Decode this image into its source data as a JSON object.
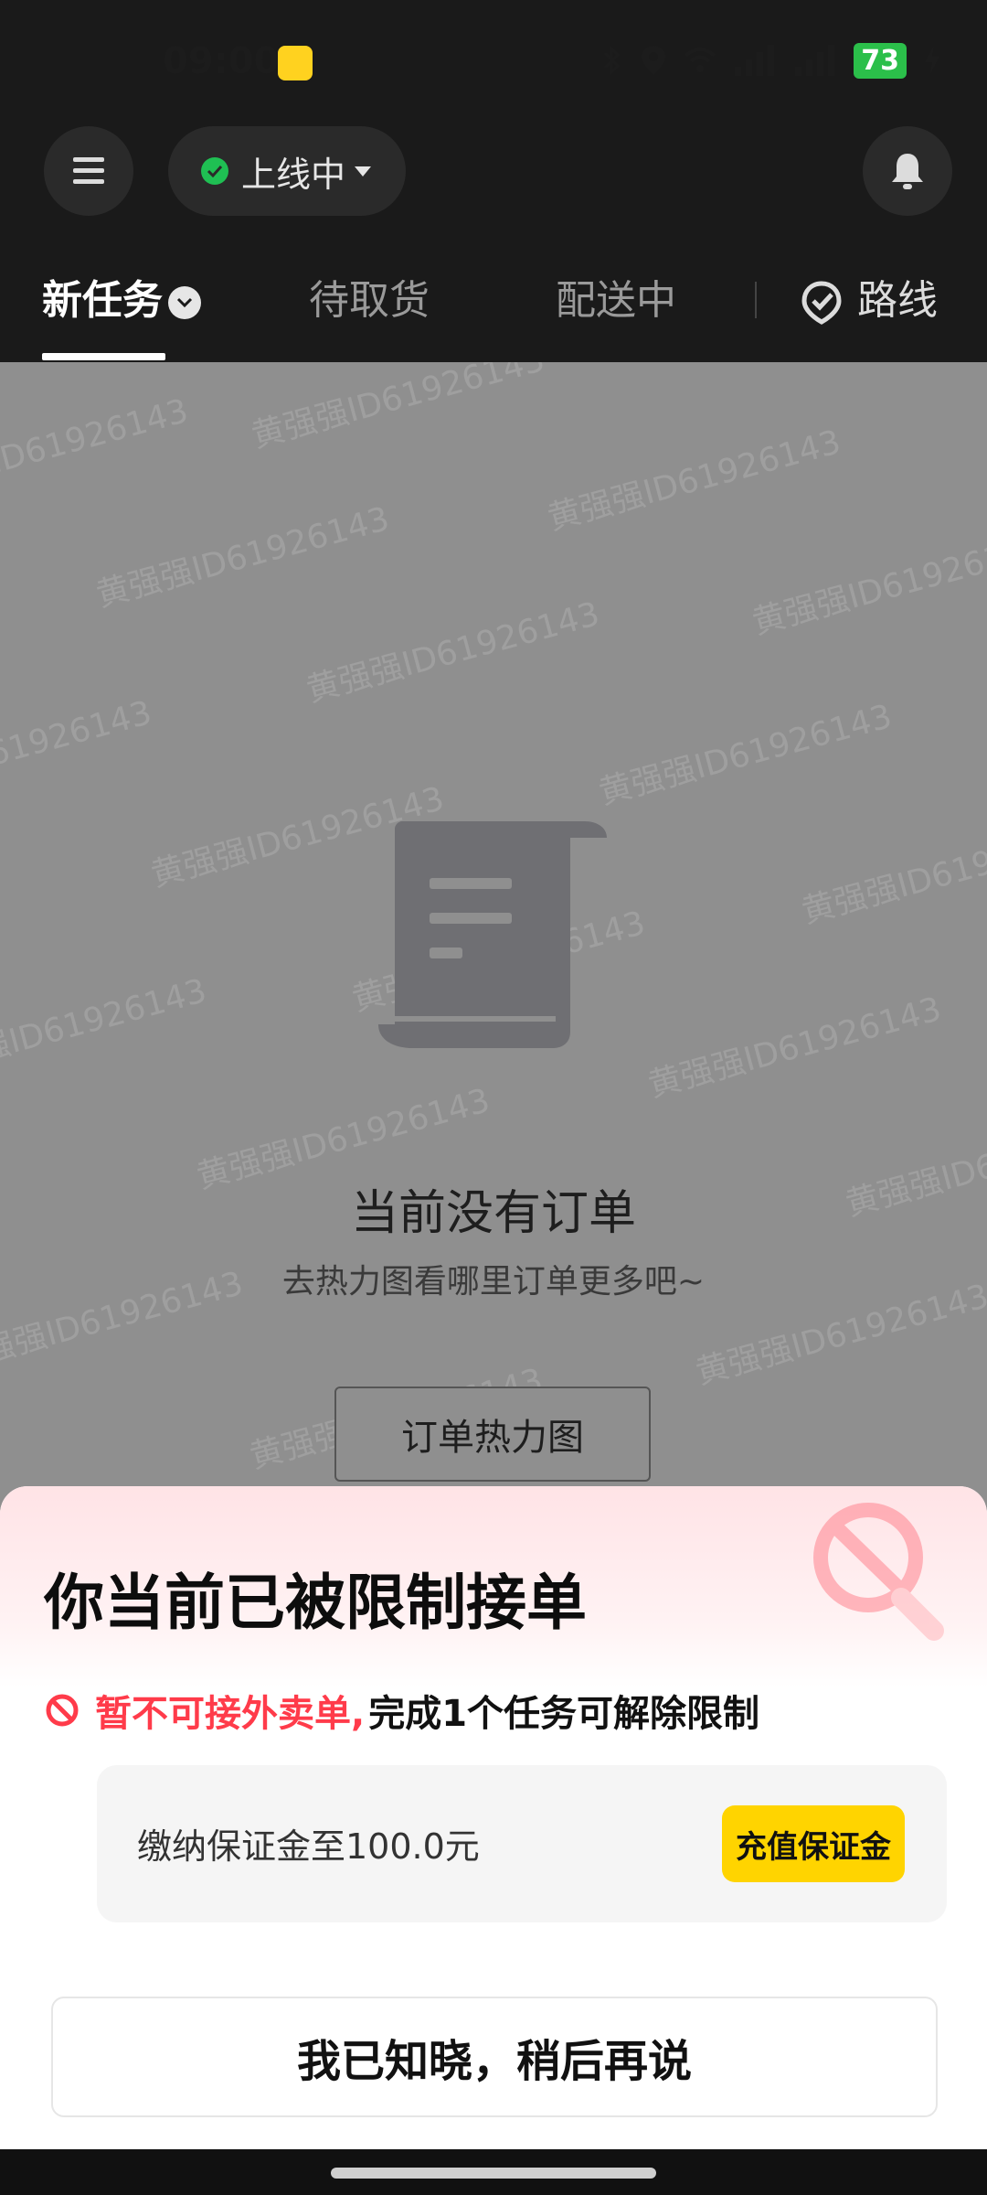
{
  "status_bar": {
    "time": "09:00",
    "battery": "73"
  },
  "header": {
    "online_status": "上线中"
  },
  "tabs": [
    {
      "label": "新任务"
    },
    {
      "label": "待取货"
    },
    {
      "label": "配送中"
    },
    {
      "label": "路线"
    }
  ],
  "empty_state": {
    "title": "当前没有订单",
    "subtitle": "去热力图看哪里订单更多吧~",
    "button_label": "订单热力图"
  },
  "watermark": "黄强强ID61926143",
  "sheet": {
    "title": "你当前已被限制接单",
    "restriction_red": "暂不可接外卖单,",
    "restriction_rest": "完成1个任务可解除限制",
    "deposit_text": "缴纳保证金至100.0元",
    "deposit_button": "充值保证金",
    "ack_button": "我已知晓，稍后再说"
  },
  "colors": {
    "accent_yellow": "#ffd400",
    "alert_red": "#ff3b4a",
    "online_green": "#1fbf53"
  }
}
